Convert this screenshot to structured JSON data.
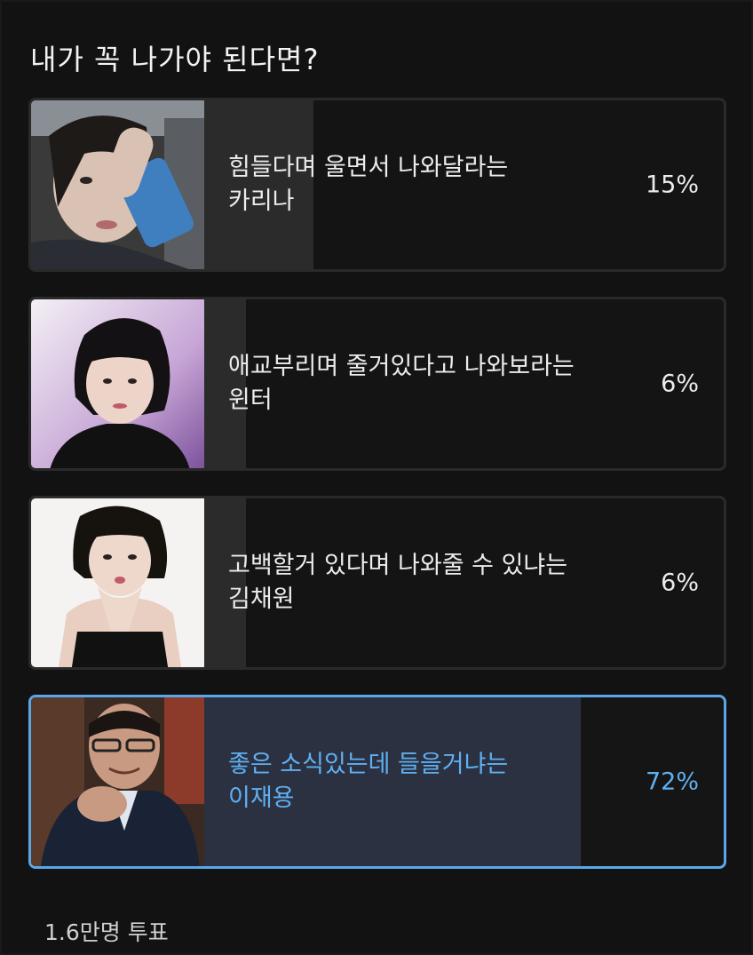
{
  "poll": {
    "title": "내가 꼭 나가야 된다면?",
    "options": [
      {
        "line1": "힘들다며 울면서 나와달라는",
        "line2": "카리나",
        "percent_label": "15%",
        "percent": 15,
        "selected": false,
        "thumb_icon": "portrait-photo"
      },
      {
        "line1": "애교부리며 줄거있다고 나와보라는",
        "line2": "윈터",
        "percent_label": "6%",
        "percent": 6,
        "selected": false,
        "thumb_icon": "portrait-photo"
      },
      {
        "line1": "고백할거 있다며 나와줄 수 있냐는",
        "line2": "김채원",
        "percent_label": "6%",
        "percent": 6,
        "selected": false,
        "thumb_icon": "portrait-photo"
      },
      {
        "line1": "좋은 소식있는데 들을거냐는",
        "line2": "이재용",
        "percent_label": "72%",
        "percent": 72,
        "selected": true,
        "thumb_icon": "portrait-photo"
      }
    ],
    "votes_label": "1.6만명 투표"
  },
  "colors": {
    "accent": "#5aa6e8",
    "background": "#121212",
    "fill_normal": "#2b2b2b",
    "fill_selected": "#2b3140"
  }
}
